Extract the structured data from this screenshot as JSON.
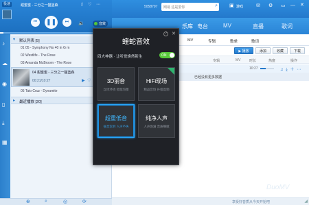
{
  "player": {
    "menu_label": "极速",
    "track_title": "甜蜜蜜 - 三分之一猫篮森",
    "time": "00:21/10:27",
    "mode_badge": "音效"
  },
  "search": {
    "user_id": "5058797",
    "placeholder": "网易 这是爱你",
    "game_label": "游戏"
  },
  "nav": {
    "tabs": [
      "乐库",
      "电台",
      "MV",
      "直播",
      "歌词"
    ]
  },
  "playlist": {
    "header": "默认列表 [5]",
    "items": [
      "01 05 - Symphony No 40 in G m",
      "02 Westlife - The Rose",
      "03 Amanda McBroom - The Rose",
      "04 甜蜜蜜 - 三分之一猫篮森",
      "05 Taio Cruz - Dynamite"
    ],
    "now_time": "00:21/10:27",
    "recent_header": "最近播放 [20]"
  },
  "main": {
    "tabs": [
      "MV",
      "专辑",
      "歌单",
      "歌词"
    ],
    "actions": [
      "播放",
      "添加",
      "收藏",
      "下载"
    ],
    "columns": [
      "专辑",
      "MV",
      "时长",
      "热度",
      "操作"
    ],
    "row_time": "10:27",
    "more_text": "已经没有更多数据",
    "watermark": "DuoMV",
    "footer_text": "享受好音质从今天开始吧"
  },
  "popup": {
    "title": "蝰蛇音效",
    "help": "?",
    "subtitle": "四大神器 · 让听觉焕然新生",
    "toggle": "ON",
    "tiles": [
      {
        "title": "3D丽音",
        "sub": "立体环绕 智能均衡"
      },
      {
        "title": "HiFi现场",
        "sub": "精品音场 补偿高频"
      },
      {
        "title": "超重低音",
        "sub": "低音澎湃 人声不失"
      },
      {
        "title": "纯净人声",
        "sub": "人声饱满 音质细腻"
      }
    ]
  },
  "colors": {
    "brand_blue": "#2479cc",
    "popup_bg": "#1f2126",
    "accent_green": "#57c93a",
    "highlight_blue": "#28a8ff"
  }
}
